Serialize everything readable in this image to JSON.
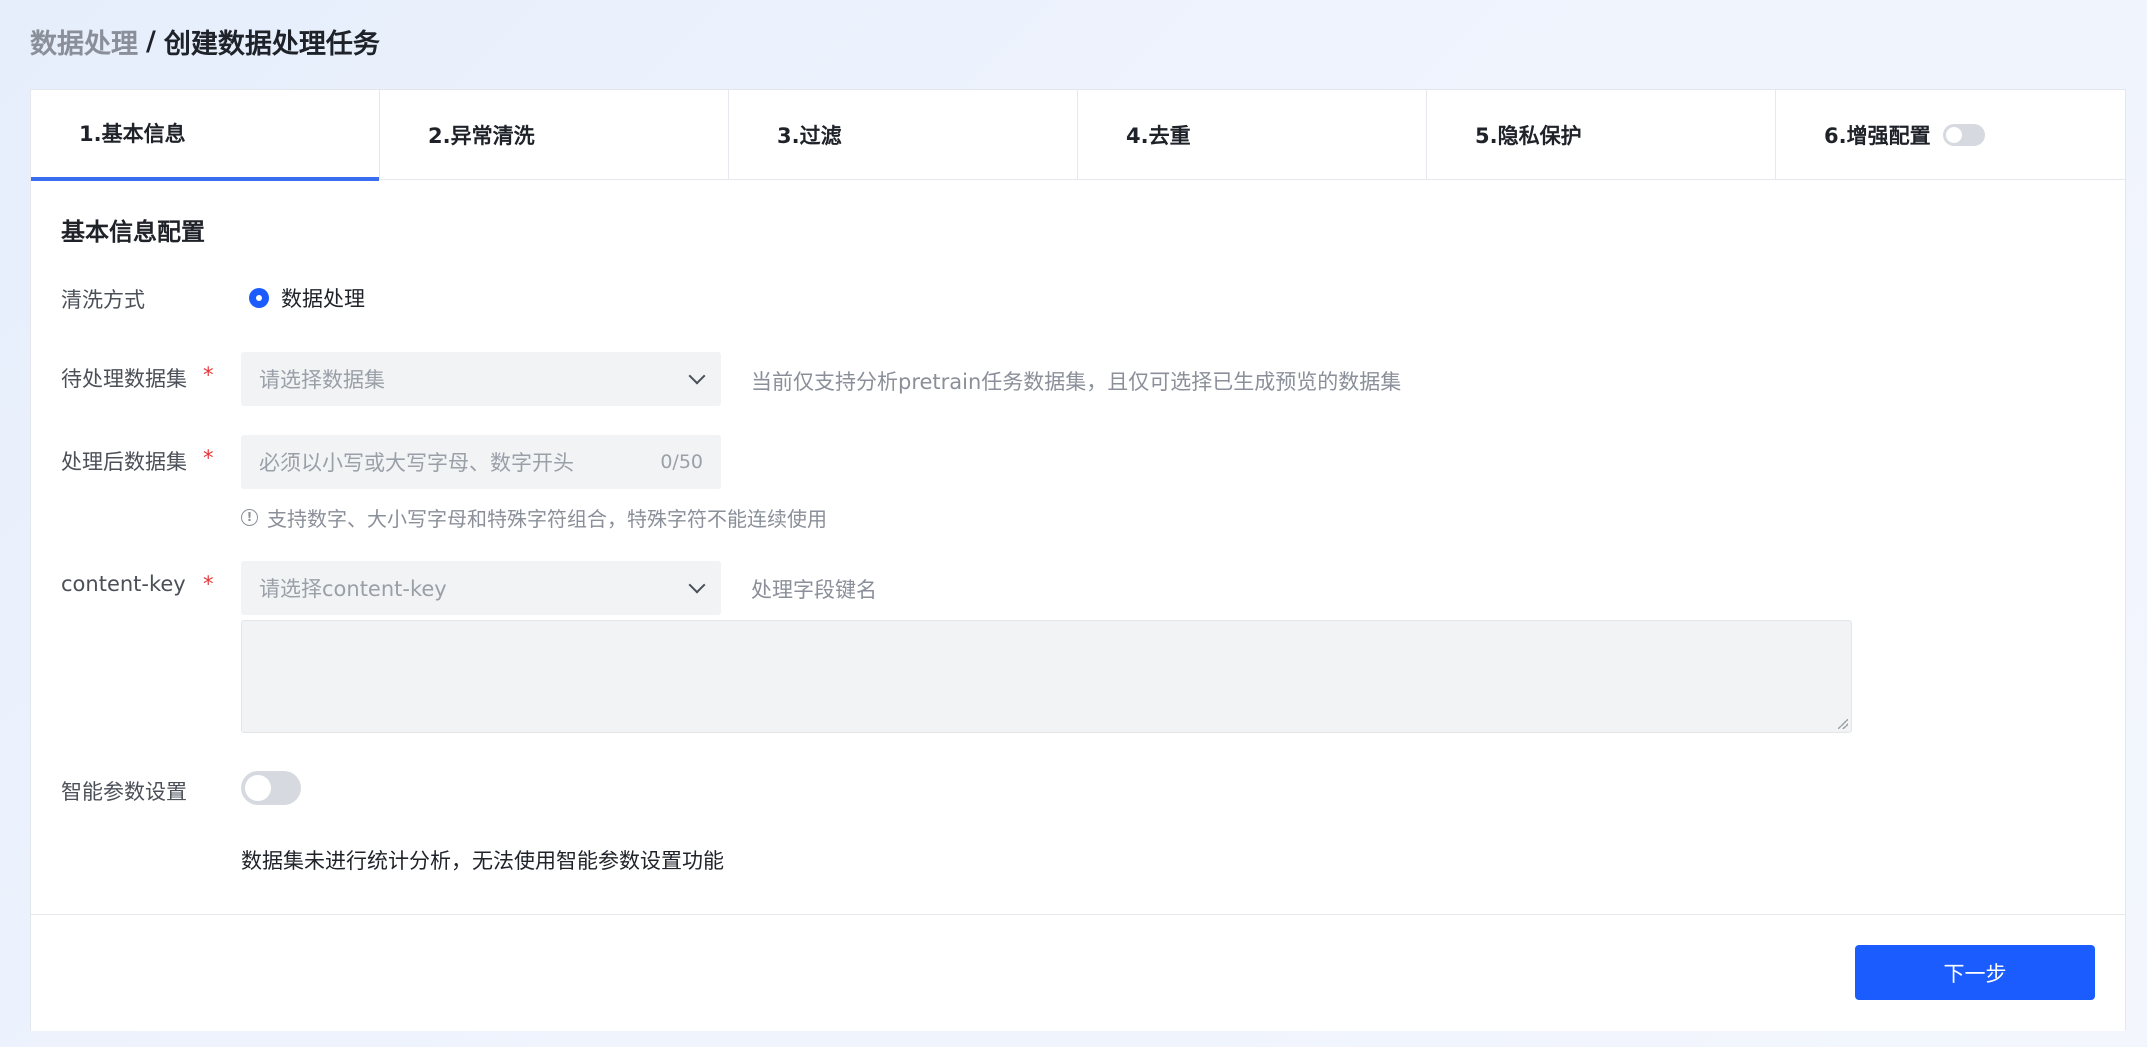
{
  "breadcrumb": {
    "parent": "数据处理",
    "separator": "/",
    "current": "创建数据处理任务"
  },
  "tabs": [
    {
      "label": "1.基本信息",
      "active": true
    },
    {
      "label": "2.异常清洗",
      "active": false
    },
    {
      "label": "3.过滤",
      "active": false
    },
    {
      "label": "4.去重",
      "active": false
    },
    {
      "label": "5.隐私保护",
      "active": false
    },
    {
      "label": "6.增强配置",
      "active": false,
      "toggle_on": false
    }
  ],
  "form": {
    "section_title": "基本信息配置",
    "clean_method": {
      "label": "清洗方式",
      "option": "数据处理",
      "selected": true
    },
    "source_dataset": {
      "label": "待处理数据集",
      "required_mark": "*",
      "placeholder": "请选择数据集",
      "hint": "当前仅支持分析pretrain任务数据集，且仅可选择已生成预览的数据集"
    },
    "output_dataset": {
      "label": "处理后数据集",
      "required_mark": "*",
      "placeholder": "必须以小写或大写字母、数字开头",
      "counter": "0/50",
      "tip": "支持数字、大小写字母和特殊字符组合，特殊字符不能连续使用"
    },
    "content_key": {
      "label": "content-key",
      "required_mark": "*",
      "placeholder": "请选择content-key",
      "hint": "处理字段键名",
      "textarea_value": ""
    },
    "smart_params": {
      "label": "智能参数设置",
      "enabled": false,
      "notice": "数据集未进行统计分析，无法使用智能参数设置功能"
    }
  },
  "footer": {
    "next_label": "下一步"
  },
  "colors": {
    "primary": "#1b5cff",
    "tab_active": "#3a6ef0",
    "required": "#e5383b"
  }
}
